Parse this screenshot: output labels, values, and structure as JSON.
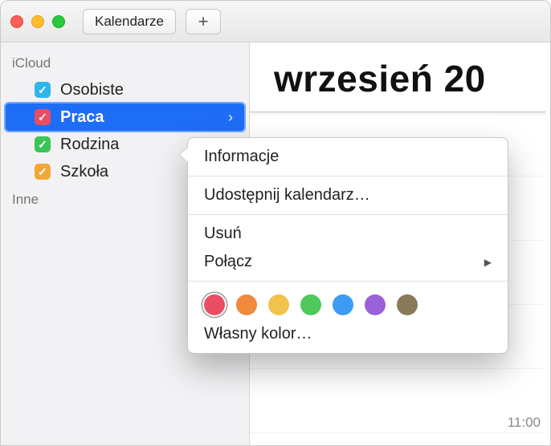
{
  "toolbar": {
    "calendars_button_label": "Kalendarze",
    "add_button_glyph": "+"
  },
  "sidebar": {
    "sections": [
      {
        "title": "iCloud"
      },
      {
        "title": "Inne"
      }
    ],
    "items": [
      {
        "label": "Osobiste",
        "color": "#2fb6ec",
        "checked": true,
        "selected": false
      },
      {
        "label": "Praca",
        "color": "#e94e63",
        "checked": true,
        "selected": true
      },
      {
        "label": "Rodzina",
        "color": "#3bc557",
        "checked": true,
        "selected": false
      },
      {
        "label": "Szkoła",
        "color": "#f2a837",
        "checked": true,
        "selected": false
      }
    ]
  },
  "main": {
    "month_title": "wrzesień 20",
    "time_label": "11:00"
  },
  "context_menu": {
    "info": "Informacje",
    "share": "Udostępnij kalendarz…",
    "delete": "Usuń",
    "merge": "Połącz",
    "custom_color": "Własny kolor…",
    "swatches": [
      {
        "color": "#e94e63",
        "selected": true
      },
      {
        "color": "#f08a3c",
        "selected": false
      },
      {
        "color": "#f1c24c",
        "selected": false
      },
      {
        "color": "#4fc95b",
        "selected": false
      },
      {
        "color": "#3e9bf5",
        "selected": false
      },
      {
        "color": "#9a62d8",
        "selected": false
      },
      {
        "color": "#8a7a5a",
        "selected": false
      }
    ]
  }
}
